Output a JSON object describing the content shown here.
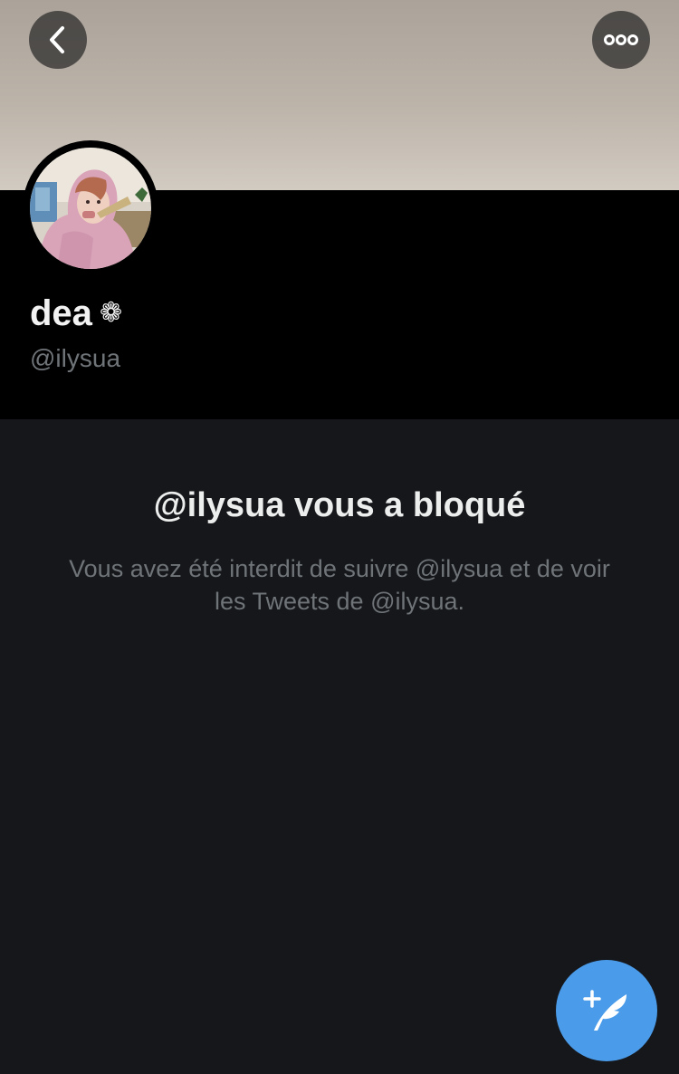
{
  "header": {
    "back_icon": "chevron-left-icon",
    "more_icon": "more-horizontal-icon",
    "banner_color": "#bcb3a9"
  },
  "profile": {
    "display_name": "dea",
    "name_emoji": "❁",
    "handle": "@ilysua"
  },
  "blocked": {
    "title": "@ilysua vous a bloqué",
    "description": "Vous avez été interdit de suivre @ilysua et de voir les Tweets de @ilysua."
  },
  "fab": {
    "icon": "compose-tweet-icon",
    "color": "#4a9ceb"
  }
}
